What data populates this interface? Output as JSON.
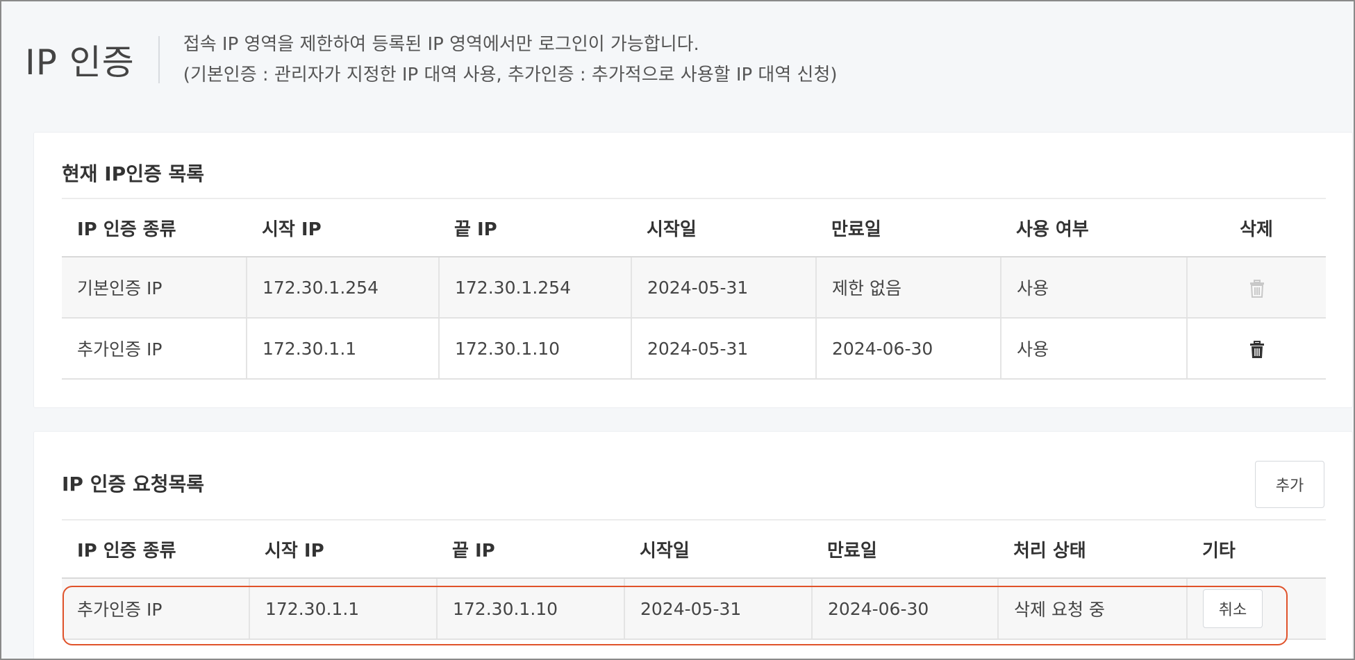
{
  "header": {
    "title": "IP 인증",
    "desc_line1": "접속 IP 영역을 제한하여 등록된 IP 영역에서만 로그인이 가능합니다.",
    "desc_line2": "(기본인증 : 관리자가 지정한 IP 대역 사용, 추가인증 : 추가적으로 사용할 IP 대역 신청)"
  },
  "current": {
    "title": "현재 IP인증 목록",
    "columns": [
      "IP 인증 종류",
      "시작 IP",
      "끝 IP",
      "시작일",
      "만료일",
      "사용 여부",
      "삭제"
    ],
    "rows": [
      {
        "type": "기본인증 IP",
        "start_ip": "172.30.1.254",
        "end_ip": "172.30.1.254",
        "start_date": "2024-05-31",
        "end_date": "제한 없음",
        "usage": "사용",
        "delete_icon": "trash-icon",
        "delete_enabled": false
      },
      {
        "type": "추가인증 IP",
        "start_ip": "172.30.1.1",
        "end_ip": "172.30.1.10",
        "start_date": "2024-05-31",
        "end_date": "2024-06-30",
        "usage": "사용",
        "delete_icon": "trash-icon",
        "delete_enabled": true
      }
    ]
  },
  "request": {
    "title": "IP 인증 요청목록",
    "add_label": "추가",
    "columns": [
      "IP 인증 종류",
      "시작 IP",
      "끝 IP",
      "시작일",
      "만료일",
      "처리 상태",
      "기타"
    ],
    "rows": [
      {
        "type": "추가인증 IP",
        "start_ip": "172.30.1.1",
        "end_ip": "172.30.1.10",
        "start_date": "2024-05-31",
        "end_date": "2024-06-30",
        "status": "삭제 요청 중",
        "action_label": "취소"
      }
    ]
  },
  "colors": {
    "highlight": "#e0522a",
    "trash_disabled": "#c8c8c8",
    "trash_enabled": "#333333"
  }
}
